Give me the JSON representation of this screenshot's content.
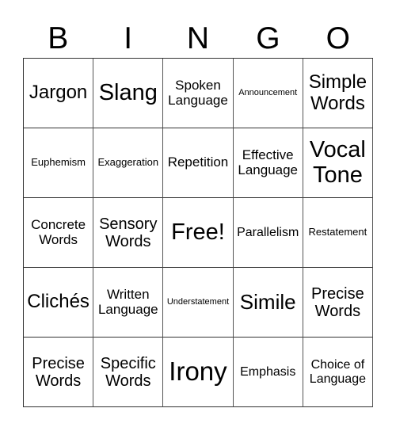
{
  "header": [
    "B",
    "I",
    "N",
    "G",
    "O"
  ],
  "cells": [
    [
      {
        "text": "Jargon",
        "size": "s6"
      },
      {
        "text": "Slang",
        "size": "s8"
      },
      {
        "text": "Spoken Language",
        "size": "s4"
      },
      {
        "text": "Announcement",
        "size": "s1"
      },
      {
        "text": "Simple Words",
        "size": "s6"
      }
    ],
    [
      {
        "text": "Euphemism",
        "size": "s2"
      },
      {
        "text": "Exaggeration",
        "size": "s2"
      },
      {
        "text": "Repetition",
        "size": "s4"
      },
      {
        "text": "Effective Language",
        "size": "s4"
      },
      {
        "text": "Vocal Tone",
        "size": "s8"
      }
    ],
    [
      {
        "text": "Concrete Words",
        "size": "s4"
      },
      {
        "text": "Sensory Words",
        "size": "s5"
      },
      {
        "text": "Free!",
        "size": "s8"
      },
      {
        "text": "Parallelism",
        "size": "s3"
      },
      {
        "text": "Restatement",
        "size": "s2"
      }
    ],
    [
      {
        "text": "Clichés",
        "size": "s6"
      },
      {
        "text": "Written Language",
        "size": "s4"
      },
      {
        "text": "Understatement",
        "size": "s1"
      },
      {
        "text": "Simile",
        "size": "s7"
      },
      {
        "text": "Precise Words",
        "size": "s5"
      }
    ],
    [
      {
        "text": "Precise Words",
        "size": "s5"
      },
      {
        "text": "Specific Words",
        "size": "s5"
      },
      {
        "text": "Irony",
        "size": "s9"
      },
      {
        "text": "Emphasis",
        "size": "s3"
      },
      {
        "text": "Choice of Language",
        "size": "s3"
      }
    ]
  ]
}
